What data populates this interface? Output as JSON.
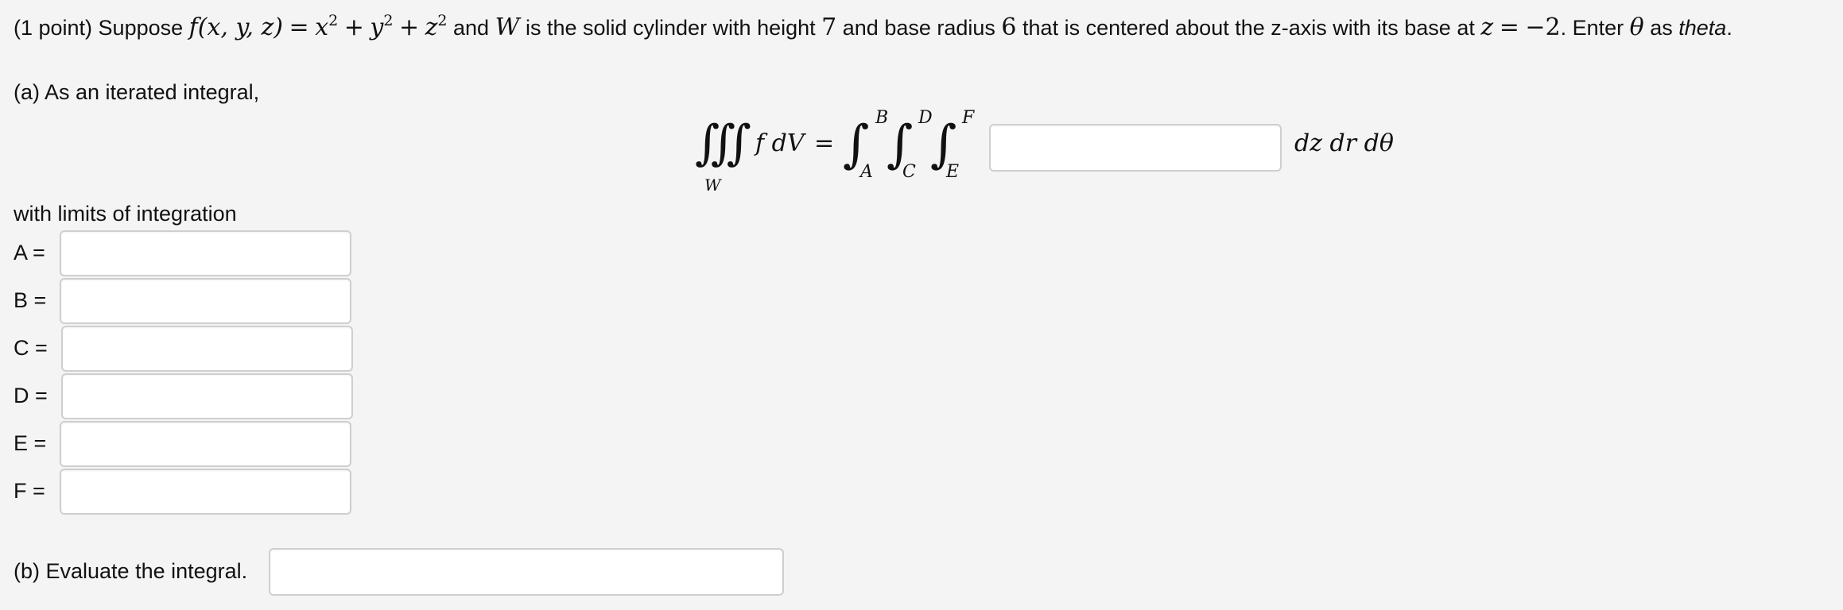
{
  "problem": {
    "points": "(1 point) Suppose",
    "func_lhs": "f(x, y, z)",
    "eq": "=",
    "x2": "x",
    "plus1": "+",
    "y2": "y",
    "plus2": "+",
    "z2": "z",
    "exp": "2",
    "and": "and",
    "W": "W",
    "mid1": "is the solid cylinder with height",
    "height": "7",
    "mid2": "and base radius",
    "radius": "6",
    "mid3": "that is centered about the z-axis with its base at",
    "zvar": "z",
    "zeq": "=",
    "zval": "−2",
    "mid4": ". Enter",
    "theta": "θ",
    "as": "as",
    "theta_word": "theta",
    "period": "."
  },
  "part_a": {
    "intro": "(a) As an iterated integral,",
    "triple_int": "∭",
    "region": "W",
    "integrand": "f dV",
    "equals": "=",
    "int_sign": "∫",
    "lim_A": "A",
    "lim_B": "B",
    "lim_C": "C",
    "lim_D": "D",
    "lim_E": "E",
    "lim_F": "F",
    "differentials": "dz dr dθ",
    "integrand_value": "",
    "limits_heading": "with limits of integration",
    "limits": [
      {
        "label": "A =",
        "value": ""
      },
      {
        "label": "B =",
        "value": ""
      },
      {
        "label": "C =",
        "value": ""
      },
      {
        "label": "D =",
        "value": ""
      },
      {
        "label": "E =",
        "value": ""
      },
      {
        "label": "F =",
        "value": ""
      }
    ]
  },
  "part_b": {
    "label": "(b) Evaluate the integral.",
    "value": ""
  }
}
